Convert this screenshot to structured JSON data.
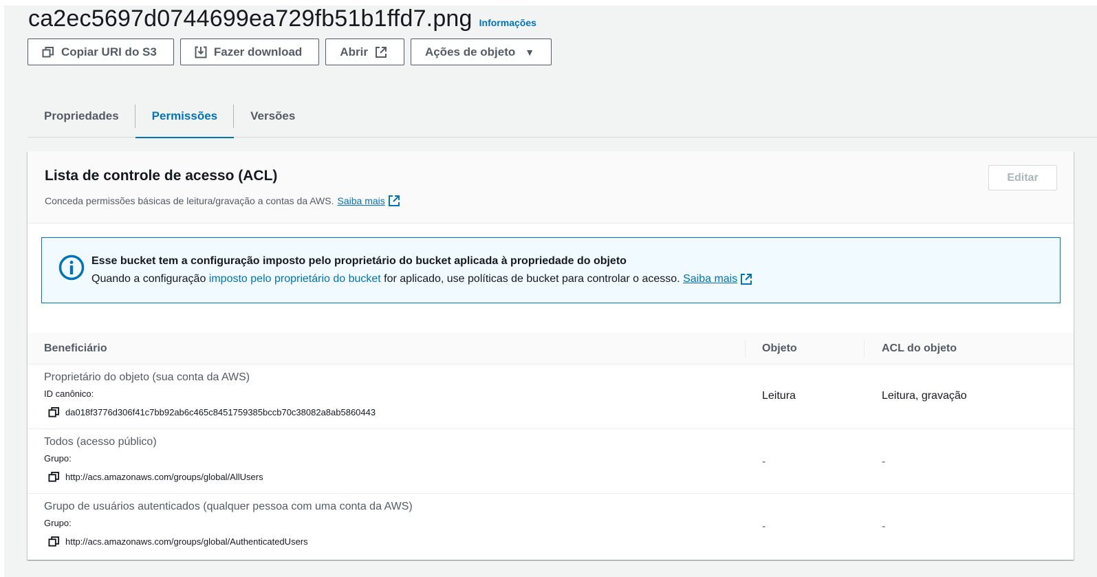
{
  "object": {
    "title": "ca2ec5697d0744699ea729fb51b1ffd7.png",
    "info_link": "Informações"
  },
  "actions": {
    "copy_uri": "Copiar URI do S3",
    "download": "Fazer download",
    "open": "Abrir",
    "object_actions": "Ações de objeto"
  },
  "tabs": [
    {
      "label": "Propriedades",
      "active": false
    },
    {
      "label": "Permissões",
      "active": true
    },
    {
      "label": "Versões",
      "active": false
    }
  ],
  "acl_panel": {
    "title": "Lista de controle de acesso (ACL)",
    "description": "Conceda permissões básicas de leitura/gravação a contas da AWS.",
    "learn_more": "Saiba mais",
    "edit_label": "Editar"
  },
  "alert": {
    "title": "Esse bucket tem a configuração imposto pelo proprietário do bucket aplicada à propriedade do objeto",
    "body_prefix": "Quando a configuração ",
    "body_link": "imposto pelo proprietário do bucket",
    "body_suffix": " for aplicado, use políticas de bucket para controlar o acesso. ",
    "learn_more": "Saiba mais"
  },
  "table": {
    "headers": {
      "grantee": "Beneficiário",
      "object": "Objeto",
      "object_acl": "ACL do objeto"
    },
    "rows": [
      {
        "grantee": "Proprietário do objeto (sua conta da AWS)",
        "id_label": "ID canônico:",
        "id_value": "da018f3776d306f41c7bb92ab6c465c8451759385bccb70c38082a8ab5860443",
        "object": "Leitura",
        "object_acl": "Leitura, gravação"
      },
      {
        "grantee": "Todos (acesso público)",
        "id_label": "Grupo:",
        "id_value": "http://acs.amazonaws.com/groups/global/AllUsers",
        "object": "-",
        "object_acl": "-"
      },
      {
        "grantee": "Grupo de usuários autenticados (qualquer pessoa com uma conta da AWS)",
        "id_label": "Grupo:",
        "id_value": "http://acs.amazonaws.com/groups/global/AuthenticatedUsers",
        "object": "-",
        "object_acl": "-"
      }
    ]
  },
  "colors": {
    "accent": "#0073bb",
    "alert_bg": "#f1faff",
    "text_secondary": "#545b64"
  },
  "icons": [
    "copy-icon",
    "download-icon",
    "external-link-icon",
    "caret-down-icon",
    "info-icon"
  ]
}
